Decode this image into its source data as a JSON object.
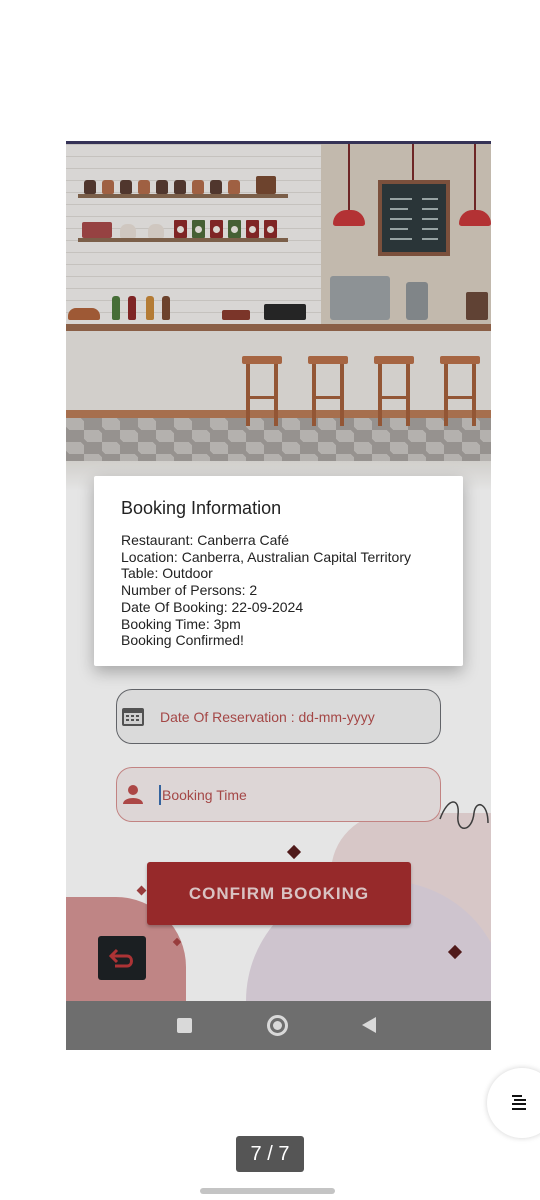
{
  "dialog": {
    "title": "Booking Information",
    "lines": [
      "Restaurant: Canberra Café",
      "Location: Canberra, Australian Capital Territory",
      "Table: Outdoor",
      "Number of Persons: 2",
      "Date Of Booking: 22-09-2024",
      "Booking Time: 3pm",
      "Booking Confirmed!"
    ]
  },
  "form": {
    "date_placeholder": "Date Of Reservation : dd-mm-yyyy",
    "time_placeholder": "Booking Time",
    "confirm_label": "CONFIRM BOOKING"
  },
  "icons": {
    "date": "calendar-icon",
    "time": "person-icon",
    "back": "back-arrow-icon",
    "nav_recents": "square-icon",
    "nav_home": "circle-icon",
    "nav_back": "triangle-back-icon",
    "viewer_menu": "menu-lines-icon"
  },
  "colors": {
    "accent": "#a72e2f",
    "field_text": "#b7504f",
    "dialog_bg": "#ffffff",
    "navbar": "#7b7b7b"
  },
  "viewer": {
    "page_indicator": "7 / 7"
  }
}
